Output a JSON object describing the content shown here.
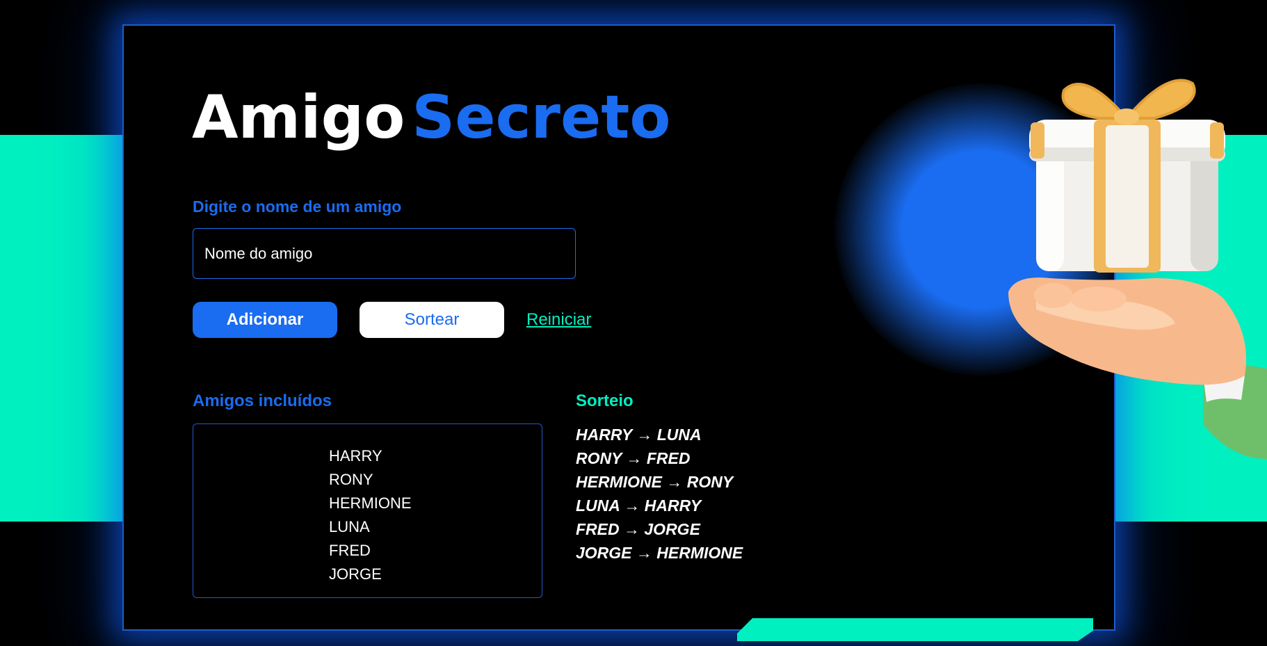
{
  "title": {
    "word1": "Amigo",
    "word2": "Secreto"
  },
  "form": {
    "label": "Digite o nome de um amigo",
    "input_placeholder": "Nome do amigo",
    "input_value": ""
  },
  "buttons": {
    "add_label": "Adicionar",
    "draw_label": "Sortear",
    "reset_label": "Reiniciar"
  },
  "friends": {
    "title": "Amigos incluídos",
    "items": [
      "HARRY",
      "RONY",
      "HERMIONE",
      "LUNA",
      "FRED",
      "JORGE"
    ]
  },
  "draw": {
    "title": "Sorteio",
    "results": [
      "HARRY → LUNA",
      "RONY → FRED",
      "HERMIONE → RONY",
      "LUNA → HARRY",
      "FRED → JORGE",
      "JORGE → HERMIONE"
    ]
  },
  "illustration": {
    "icon": "gift-in-hand-icon"
  },
  "colors": {
    "background": "#000000",
    "accent_blue": "#1a6cf0",
    "accent_green": "#00f0c0",
    "text": "#ffffff"
  }
}
